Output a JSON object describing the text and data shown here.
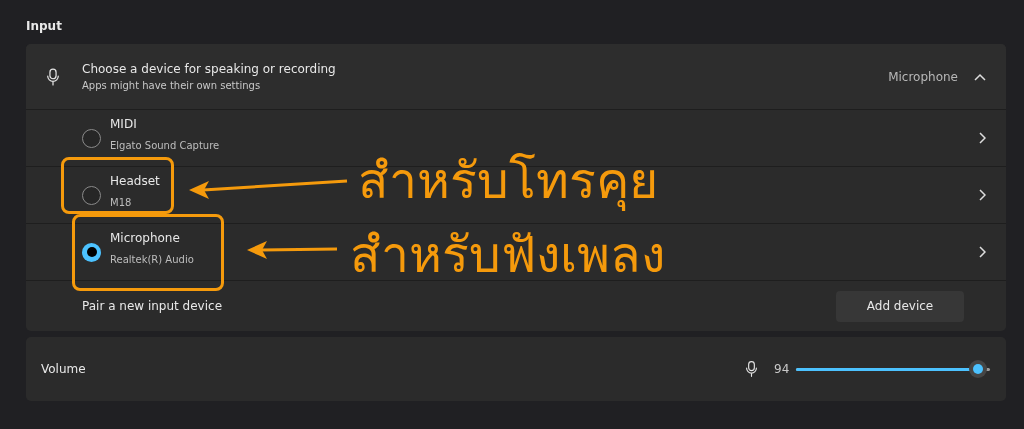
{
  "section_title": "Input",
  "device_picker": {
    "title": "Choose a device for speaking or recording",
    "subtitle": "Apps might have their own settings",
    "current": "Microphone",
    "expanded": true
  },
  "devices": [
    {
      "name": "MIDI",
      "detail": "Elgato Sound Capture",
      "selected": false
    },
    {
      "name": "Headset",
      "detail": "M18",
      "selected": false
    },
    {
      "name": "Microphone",
      "detail": "Realtek(R) Audio",
      "selected": true
    }
  ],
  "pair": {
    "label": "Pair a new input device",
    "button": "Add device"
  },
  "volume": {
    "label": "Volume",
    "reading": "94",
    "level": 0.94
  },
  "callouts": [
    {
      "text": "สำหรับโทรคุย"
    },
    {
      "text": "สำหรับฟังเพลง"
    }
  ]
}
